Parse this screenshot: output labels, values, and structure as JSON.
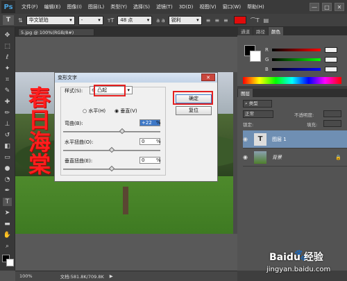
{
  "menubar": {
    "logo": "Ps",
    "items": [
      "文件(F)",
      "编辑(E)",
      "图像(I)",
      "图层(L)",
      "类型(Y)",
      "选择(S)",
      "滤镜(T)",
      "3D(D)",
      "视图(V)",
      "窗口(W)",
      "帮助(H)"
    ],
    "window_buttons": [
      "—",
      "□",
      "✕"
    ]
  },
  "options": {
    "tool_icon": "T",
    "font_family": "华文琥珀",
    "font_style": "-",
    "size": "48 点",
    "antialias": "锐利",
    "text_color": "#e10b0b"
  },
  "document": {
    "tab": "5.jpg @ 100%(RGB/8#)",
    "text_on_image": "春日海棠"
  },
  "status": {
    "zoom": "100%",
    "doc_info": "文档:581.8K/709.8K"
  },
  "panels": {
    "top_tabs": [
      "通道",
      "路径",
      "颜色"
    ],
    "color": {
      "channels": [
        "R",
        "G",
        "B"
      ]
    },
    "layer_tabs": [
      "图层"
    ],
    "layer_kind": "类型",
    "blend_mode": "正常",
    "opacity_label": "不透明度:",
    "lock_label": "锁定:",
    "fill_label": "填充:",
    "layers": [
      {
        "name": "图层 1",
        "kind": "text-layer"
      },
      {
        "name": "背景",
        "kind": "image-layer"
      }
    ]
  },
  "dialog": {
    "title": "变形文字",
    "style_label": "样式(S):",
    "style_value": "⊖ 凸起",
    "horizontal": "水平(H)",
    "vertical": "垂直(V)",
    "bend_label": "弯曲(B):",
    "bend_value": "+22",
    "hdist_label": "水平扭曲(O):",
    "hdist_value": "0",
    "vdist_label": "垂直扭曲(E):",
    "vdist_value": "0",
    "percent": "%",
    "ok": "确定",
    "reset": "复位",
    "close": "✕",
    "bend_level_pct": 22,
    "hdist_level_pct": 0,
    "vdist_level_pct": 0
  },
  "watermark": {
    "brand": "Baidu 经验",
    "url": "jingyan.baidu.com"
  }
}
